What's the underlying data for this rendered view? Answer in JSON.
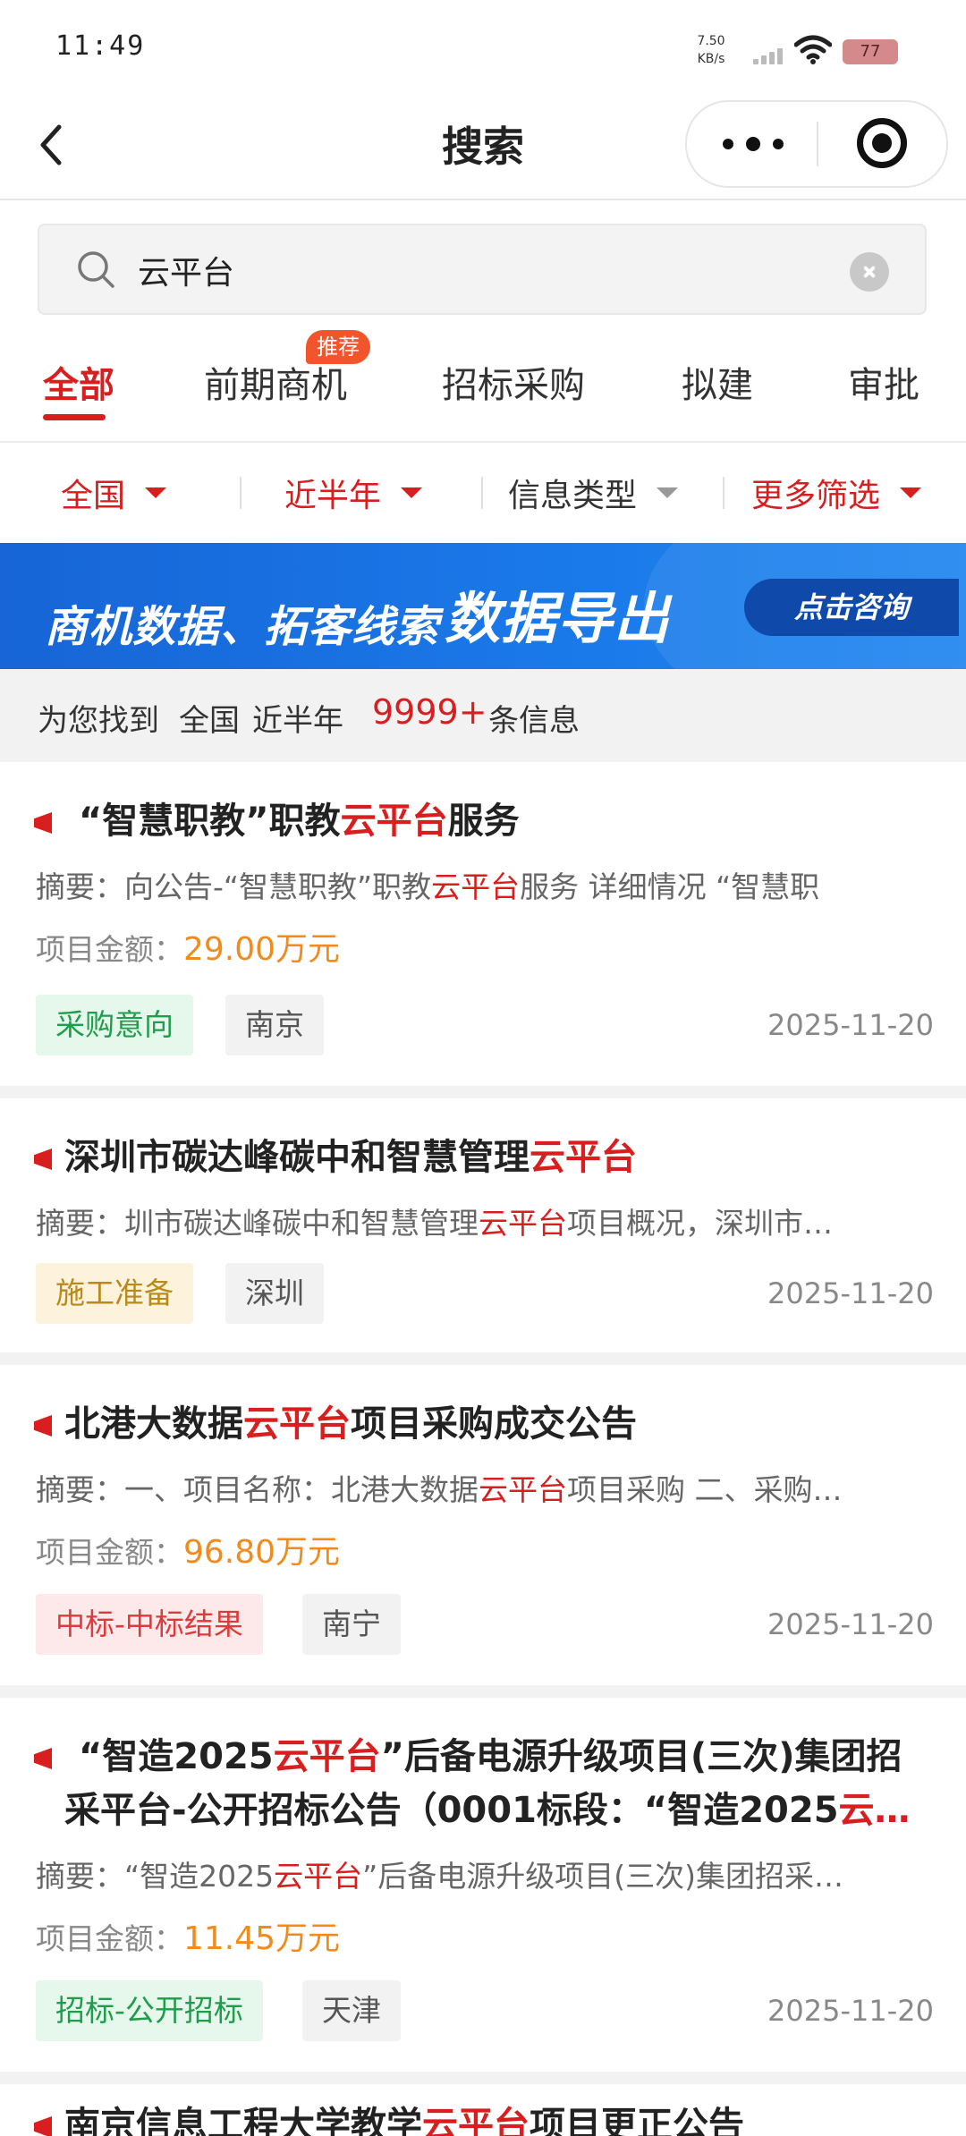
{
  "status_bar": {
    "time": "11:49",
    "net_speed_value": "7.50",
    "net_speed_unit": "KB/s",
    "battery": "77"
  },
  "nav": {
    "title": "搜索",
    "back_icon": "chevron-left-icon",
    "more_icon": "more-dots-icon",
    "close_icon": "target-icon"
  },
  "search": {
    "query": "云平台",
    "icon": "search-icon",
    "clear_icon": "clear-icon"
  },
  "tabs": [
    {
      "label": "全部",
      "active": true
    },
    {
      "label": "前期商机",
      "badge": "推荐"
    },
    {
      "label": "招标采购"
    },
    {
      "label": "拟建"
    },
    {
      "label": "审批"
    }
  ],
  "filters": [
    {
      "label": "全国",
      "active": true
    },
    {
      "label": "近半年",
      "active": true
    },
    {
      "label": "信息类型",
      "active": false
    },
    {
      "label": "更多筛选",
      "active": true
    }
  ],
  "banner": {
    "text": "商机数据、拓客线索",
    "emphasis": "数据导出",
    "button": "点击咨询"
  },
  "result_summary": {
    "prefix": "为您找到",
    "region": "全国",
    "period": "近半年",
    "count": "9999+",
    "suffix": "条信息"
  },
  "abstract_label": "摘要：",
  "amount_label": "项目金额：",
  "keyword": "云平台",
  "cards": [
    {
      "title_before": "“智慧职教”职教",
      "title_keyword": "云平台",
      "title_after": "服务",
      "abstract_before": "向公告-“智慧职教”职教",
      "abstract_keyword": "云平台",
      "abstract_after": "服务 详细情况 “智慧职",
      "amount": "29.00万元",
      "status_tag": "采购意向",
      "status_color": "#1f9d4a",
      "region_tag": "南京",
      "date": "2025-11-20"
    },
    {
      "title_before": "深圳市碳达峰碳中和智慧管理",
      "title_keyword": "云平台",
      "title_after": "",
      "abstract_before": "圳市碳达峰碳中和智慧管理",
      "abstract_keyword": "云平台",
      "abstract_after": "项目概况，深圳市…",
      "status_tag": "施工准备",
      "status_color": "#b98a1b",
      "region_tag": "深圳",
      "date": "2025-11-20"
    },
    {
      "title_before": "北港大数据",
      "title_keyword": "云平台",
      "title_after": "项目采购成交公告",
      "abstract_before": "一、项目名称：北港大数据",
      "abstract_keyword": "云平台",
      "abstract_after": "项目采购 二、采购…",
      "amount": "96.80万元",
      "status_tag": "中标-中标结果",
      "status_color": "#dd3b3b",
      "region_tag": "南宁",
      "date": "2025-11-20"
    },
    {
      "title_before": "“智造2025",
      "title_keyword": "云平台",
      "title_after": "”后备电源升级项目(三次)集团招采平台-公开招标公告（0001标段：“智造2025",
      "title_tail_keyword": "云…",
      "abstract_before": "“智造2025",
      "abstract_keyword": "云平台",
      "abstract_after": "”后备电源升级项目(三次)集团招采…",
      "amount": "11.45万元",
      "status_tag": "招标-公开招标",
      "status_color": "#1f9d4a",
      "region_tag": "天津",
      "date": "2025-11-20"
    },
    {
      "title_before": "南京信息工程大学教学",
      "title_keyword": "云平台",
      "title_after": "项目更正公告"
    }
  ]
}
